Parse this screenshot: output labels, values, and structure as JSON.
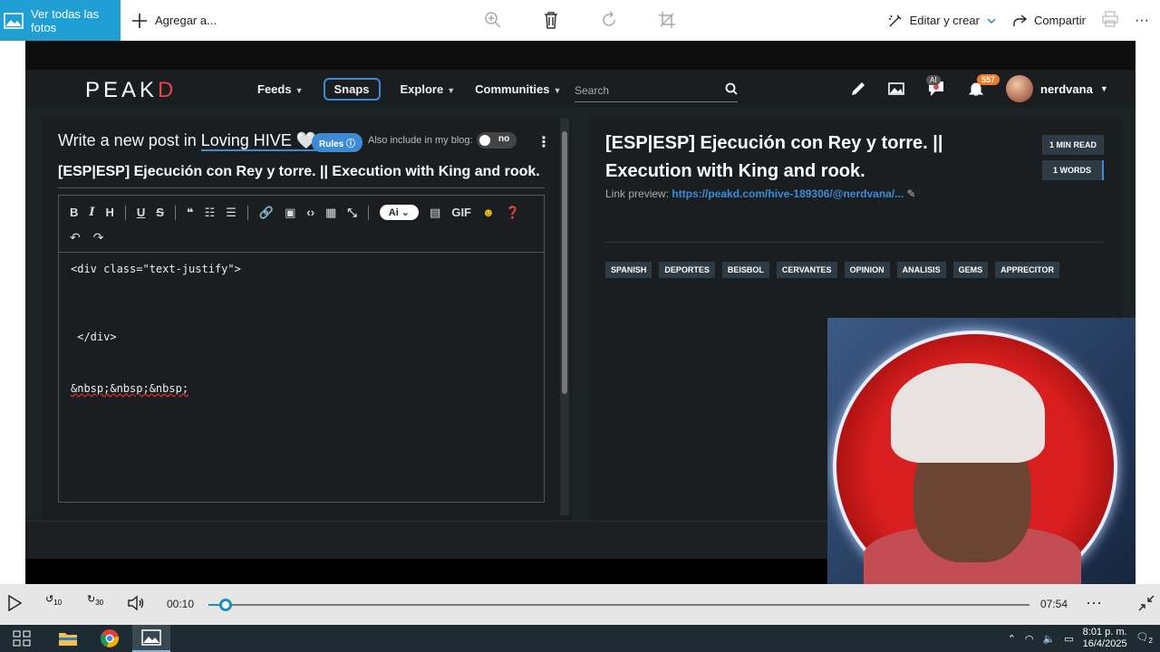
{
  "photos_toolbar": {
    "view_all_label": "Ver todas las fotos",
    "add_label": "Agregar a...",
    "edit_create_label": "Editar y crear",
    "share_label": "Compartir"
  },
  "peakd": {
    "logo_main": "PE",
    "logo_mid": "A",
    "logo_k": "K",
    "logo_d": "D",
    "nav": {
      "feeds": "Feeds",
      "snaps": "Snaps",
      "explore": "Explore",
      "communities": "Communities"
    },
    "search_placeholder": "Search",
    "ai_badge": "AI",
    "notifications_count": "557",
    "username": "nerdvana"
  },
  "editor": {
    "title_prefix": "Write a new post in",
    "community": "Loving HIVE 🤍",
    "rules_label": "Rules",
    "also_include": "Also include in my blog:",
    "toggle_value": "no",
    "post_title": "[ESP|ESP] Ejecución con Rey y torre. || Execution with King and rook.",
    "toolbar": {
      "bold": "B",
      "italic": "I",
      "heading": "H",
      "underline": "U",
      "strike": "S",
      "ai": "Ai",
      "gif": "GIF"
    },
    "code_lines": [
      "<div class=\"text-justify\">",
      " </div>",
      "&nbsp;&nbsp;&nbsp;"
    ]
  },
  "preview": {
    "title": "[ESP|ESP] Ejecución con Rey y torre. || Execution with King and rook.",
    "link_label": "Link preview:",
    "link_url": "https://peakd.com/hive-189306/@nerdvana/...",
    "min_read": "1 MIN READ",
    "words": "1 WORDS",
    "tags": [
      "SPANISH",
      "DEPORTES",
      "BEISBOL",
      "CERVANTES",
      "OPINION",
      "ANALISIS",
      "GEMS",
      "APPRECITOR"
    ]
  },
  "media": {
    "current_time": "00:10",
    "total_time": "07:54",
    "progress_fraction": 0.021,
    "skip_back": "10",
    "skip_fwd": "30"
  },
  "taskbar": {
    "time": "8:01 p. m.",
    "date": "16/4/2025",
    "notifications": "2"
  },
  "colors": {
    "accent": "#1f9fd4",
    "peakd_blue": "#3d8bd6",
    "peakd_red": "#e1484c"
  }
}
